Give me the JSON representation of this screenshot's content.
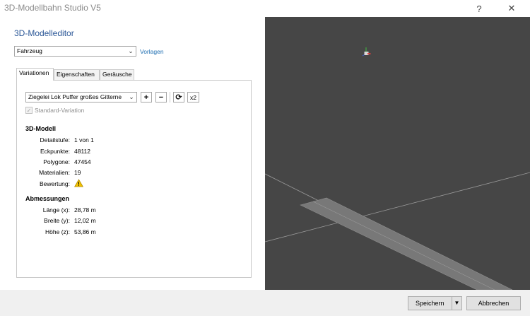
{
  "window": {
    "title": "3D-Modellbahn Studio V5",
    "help_glyph": "?",
    "close_glyph": "✕"
  },
  "editor": {
    "title": "3D-Modelleditor",
    "type_select": "Fahrzeug",
    "templates_link": "Vorlagen"
  },
  "tabs": [
    {
      "label": "Variationen",
      "active": true
    },
    {
      "label": "Eigenschaften",
      "active": false
    },
    {
      "label": "Geräusche",
      "active": false
    }
  ],
  "variation": {
    "selected": "Ziegelei Lok Puffer großes Gitterne",
    "add_glyph": "+",
    "remove_glyph": "−",
    "refresh_glyph": "⟳",
    "duplicate_label": "x2",
    "standard_label": "Standard-Variation",
    "standard_checked": true
  },
  "model3d": {
    "title": "3D-Modell",
    "rows": [
      {
        "label": "Detailstufe:",
        "value": "1 von 1"
      },
      {
        "label": "Eckpunkte:",
        "value": "48112"
      },
      {
        "label": "Polygone:",
        "value": "47454"
      },
      {
        "label": "Materialien:",
        "value": "19"
      },
      {
        "label": "Bewertung:",
        "value": "",
        "icon": "warning-icon"
      }
    ]
  },
  "dimensions": {
    "title": "Abmessungen",
    "rows": [
      {
        "label": "Länge (x):",
        "value": "28,78 m"
      },
      {
        "label": "Breite (y):",
        "value": "12,02 m"
      },
      {
        "label": "Höhe (z):",
        "value": "53,86 m"
      }
    ]
  },
  "footer": {
    "save_label": "Speichern",
    "cancel_label": "Abbrechen",
    "dropdown_glyph": "▼"
  },
  "colors": {
    "viewport_bg": "#464646",
    "accent": "#2b5797",
    "warning": "#f2c200"
  }
}
